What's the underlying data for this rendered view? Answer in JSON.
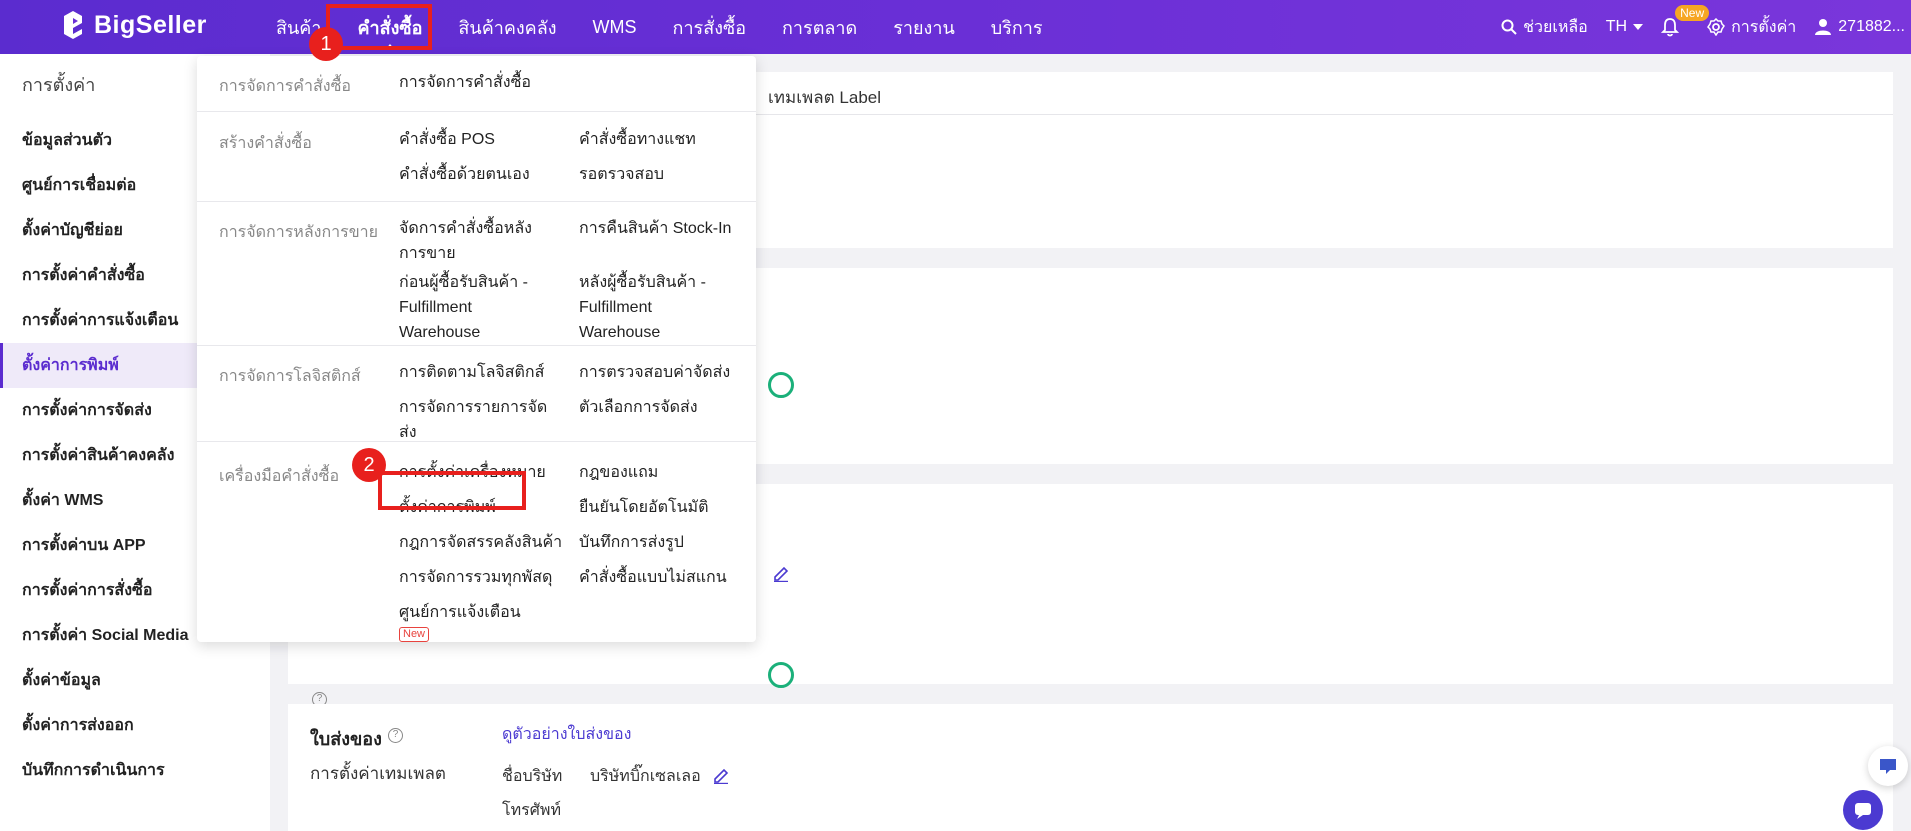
{
  "brand": {
    "name": "BigSeller"
  },
  "nav": {
    "items": [
      "สินค้า",
      "คำสั่งซื้อ",
      "สินค้าคงคลัง",
      "WMS",
      "การสั่งซื้อ",
      "การตลาด",
      "รายงาน",
      "บริการ"
    ],
    "active_index": 1
  },
  "topbar": {
    "help": "ช่วยเหลือ",
    "lang": "TH",
    "notify_badge": "New",
    "settings": "การตั้งค่า",
    "user": "271882..."
  },
  "sidebar": {
    "title": "การตั้งค่า",
    "items": [
      "ข้อมูลส่วนตัว",
      "ศูนย์การเชื่อมต่อ",
      "ตั้งค่าบัญชีย่อย",
      "การตั้งค่าคำสั่งซื้อ",
      "การตั้งค่าการแจ้งเตือน",
      "ตั้งค่าการพิมพ์",
      "การตั้งค่าการจัดส่ง",
      "การตั้งค่าสินค้าคงคลัง",
      "ตั้งค่า WMS",
      "การตั้งค่าบน APP",
      "การตั้งค่าการสั่งซื้อ",
      "การตั้งค่า Social Media",
      "ตั้งค่าข้อมูล",
      "ตั้งค่าการส่งออก",
      "บันทึกการดำเนินการ"
    ],
    "active_index": 5
  },
  "main": {
    "tab_label": "เทมเพลต Label",
    "delivery": {
      "title": "ใบส่งของ",
      "preview_link": "ดูตัวอย่างใบส่งของ",
      "template_settings": "การตั้งค่าเทมเพลต",
      "company_label": "ชื่อบริษัท",
      "company_value": "บริษัทบิ๊กเซลเลอ",
      "phone_label": "โทรศัพท์"
    }
  },
  "dropdown": {
    "sections": [
      {
        "category": "การจัดการคำสั่งซื้อ",
        "links": [
          "การจัดการคำสั่งซื้อ"
        ]
      },
      {
        "category": "สร้างคำสั่งซื้อ",
        "links": [
          "คำสั่งซื้อ POS",
          "คำสั่งซื้อทางแชท",
          "คำสั่งซื้อด้วยตนเอง",
          "รอตรวจสอบ"
        ]
      },
      {
        "category": "การจัดการหลังการขาย",
        "links": [
          "จัดการคำสั่งซื้อหลังการขาย",
          "การคืนสินค้า Stock-In",
          "ก่อนผู้ซื้อรับสินค้า - Fulfillment Warehouse",
          "หลังผู้ซื้อรับสินค้า - Fulfillment Warehouse"
        ]
      },
      {
        "category": "การจัดการโลจิสติกส์",
        "links": [
          "การติดตามโลจิสติกส์",
          "การตรวจสอบค่าจัดส่ง",
          "การจัดการรายการจัดส่ง",
          "ตัวเลือกการจัดส่ง"
        ]
      },
      {
        "category": "เครื่องมือคำสั่งซื้อ",
        "links": [
          "การตั้งค่าเครื่องหมาย",
          "กฎของแถม",
          "ตั้งค่าการพิมพ์",
          "ยืนยันโดยอัตโนมัติ",
          "กฎการจัดสรรคลังสินค้า",
          "บันทึกการส่งรูป",
          "การจัดการรวมทุกพัสดุ",
          "คำสั่งซื้อแบบไม่สแกน",
          "ศูนย์การแจ้งเตือน"
        ]
      }
    ],
    "new_tag": "New"
  },
  "annotations": {
    "step1": "1",
    "step2": "2"
  },
  "colors": {
    "brand": "#5b2ccf",
    "highlight": "#e8201d",
    "toggle": "#1bb07a"
  }
}
